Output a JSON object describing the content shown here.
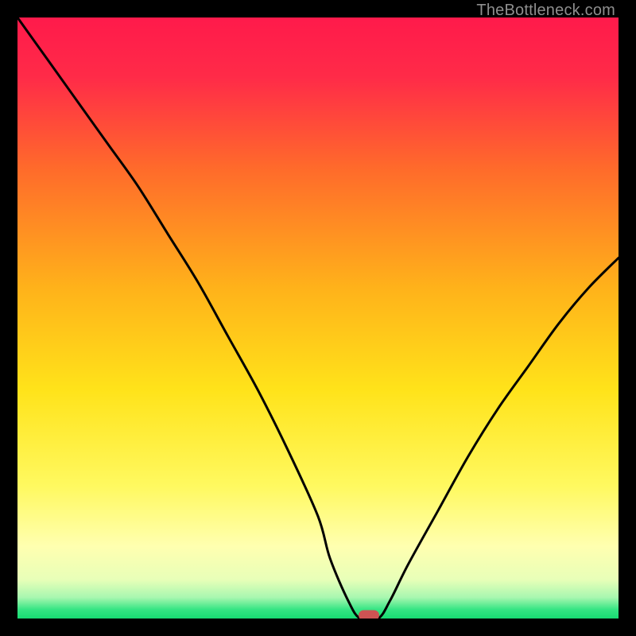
{
  "attribution": "TheBottleneck.com",
  "colors": {
    "frame": "#000000",
    "curve": "#000000",
    "marker": "#cd5353",
    "gradient_stops": [
      {
        "offset": 0.0,
        "color": "#ff1a4b"
      },
      {
        "offset": 0.1,
        "color": "#ff2b48"
      },
      {
        "offset": 0.25,
        "color": "#ff6a2b"
      },
      {
        "offset": 0.45,
        "color": "#ffb21a"
      },
      {
        "offset": 0.62,
        "color": "#ffe31a"
      },
      {
        "offset": 0.78,
        "color": "#fff960"
      },
      {
        "offset": 0.88,
        "color": "#ffffb0"
      },
      {
        "offset": 0.935,
        "color": "#e8ffb8"
      },
      {
        "offset": 0.965,
        "color": "#a8f7b0"
      },
      {
        "offset": 0.985,
        "color": "#35e583"
      },
      {
        "offset": 1.0,
        "color": "#17db72"
      }
    ]
  },
  "chart_data": {
    "type": "line",
    "title": "",
    "xlabel": "",
    "ylabel": "",
    "xlim": [
      0,
      100
    ],
    "ylim": [
      0,
      100
    ],
    "grid": false,
    "legend": false,
    "series": [
      {
        "name": "bottleneck-curve",
        "x": [
          0,
          5,
          10,
          15,
          20,
          25,
          30,
          35,
          40,
          45,
          50,
          52,
          55,
          57,
          60,
          62,
          65,
          70,
          75,
          80,
          85,
          90,
          95,
          100
        ],
        "y": [
          100,
          93,
          86,
          79,
          72,
          64,
          56,
          47,
          38,
          28,
          17,
          10,
          3,
          0,
          0,
          3,
          9,
          18,
          27,
          35,
          42,
          49,
          55,
          60
        ]
      }
    ],
    "markers": [
      {
        "name": "optimal-point",
        "x": 58.5,
        "y": 0.5
      }
    ]
  }
}
